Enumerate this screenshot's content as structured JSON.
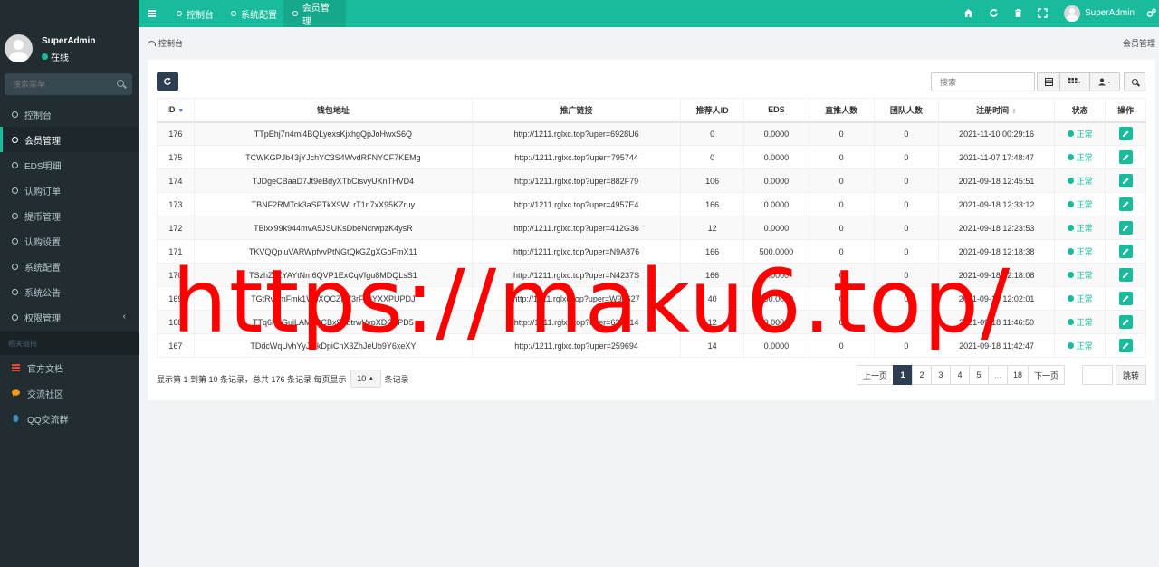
{
  "user": {
    "name": "SuperAdmin",
    "status": "在线"
  },
  "sidebar": {
    "search_placeholder": "搜索菜单",
    "items": [
      {
        "label": "控制台",
        "icon": "circle-icon"
      },
      {
        "label": "会员管理",
        "icon": "circle-icon",
        "active": true
      },
      {
        "label": "EDS明细",
        "icon": "circle-icon"
      },
      {
        "label": "认购订单",
        "icon": "circle-icon"
      },
      {
        "label": "提币管理",
        "icon": "circle-icon"
      },
      {
        "label": "认购设置",
        "icon": "circle-icon"
      },
      {
        "label": "系统配置",
        "icon": "circle-icon"
      },
      {
        "label": "系统公告",
        "icon": "circle-icon"
      },
      {
        "label": "权限管理",
        "icon": "circle-icon",
        "has_children": true
      }
    ],
    "links_header": "相关链接",
    "links": [
      {
        "label": "官方文档",
        "icon": "list-icon",
        "color": "#dd4b39"
      },
      {
        "label": "交流社区",
        "icon": "comment-icon",
        "color": "#f39c12"
      },
      {
        "label": "QQ交流群",
        "icon": "qq-icon",
        "color": "#3c8dbc"
      }
    ]
  },
  "topbar": {
    "tabs": [
      {
        "label": "控制台"
      },
      {
        "label": "系统配置"
      },
      {
        "label": "会员管理",
        "active": true
      }
    ],
    "username": "SuperAdmin",
    "icons": [
      "home-icon",
      "refresh-icon",
      "trash-icon",
      "fullscreen-icon",
      "settings-icon"
    ]
  },
  "breadcrumb": {
    "label": "控制台"
  },
  "page_title": "会员管理",
  "toolbar": {
    "search_placeholder": "搜索"
  },
  "table": {
    "headers": [
      "ID",
      "钱包地址",
      "推广链接",
      "推荐人ID",
      "EDS",
      "直推人数",
      "团队人数",
      "注册时间",
      "状态",
      "操作"
    ],
    "rows": [
      [
        "176",
        "TTpEhj7n4mi4BQLyexsKjxhgQpJoHwxS6Q",
        "http://1211.rglxc.top?uper=6928U6",
        "0",
        "0.0000",
        "0",
        "0",
        "2021-11-10 00:29:16",
        "正常"
      ],
      [
        "175",
        "TCWKGPJb43jYJchYC3S4WvdRFNYCF7KEMg",
        "http://1211.rglxc.top?uper=795744",
        "0",
        "0.0000",
        "0",
        "0",
        "2021-11-07 17:48:47",
        "正常"
      ],
      [
        "174",
        "TJDgeCBaaD7Jt9eBdyXTbCisvyUKnTHVD4",
        "http://1211.rglxc.top?uper=882F79",
        "106",
        "0.0000",
        "0",
        "0",
        "2021-09-18 12:45:51",
        "正常"
      ],
      [
        "173",
        "TBNF2RMTck3aSPTkX9WLrT1n7xX95KZruy",
        "http://1211.rglxc.top?uper=4957E4",
        "166",
        "0.0000",
        "0",
        "0",
        "2021-09-18 12:33:12",
        "正常"
      ],
      [
        "172",
        "TBixx99k944mvA5JSUKsDbeNcrwpzK4ysR",
        "http://1211.rglxc.top?uper=412G36",
        "12",
        "0.0000",
        "0",
        "0",
        "2021-09-18 12:23:53",
        "正常"
      ],
      [
        "171",
        "TKVQQpiuVARWpfvvPtNGtQkGZgXGoFmX11",
        "http://1211.rglxc.top?uper=N9A876",
        "166",
        "500.0000",
        "0",
        "0",
        "2021-09-18 12:18:38",
        "正常"
      ],
      [
        "170",
        "TSzhZcZYAYtNm6QVP1ExCqVfgu8MDQLsS1",
        "http://1211.rglxc.top?uper=N4237S",
        "166",
        "0.0000",
        "0",
        "0",
        "2021-09-18 12:18:08",
        "正常"
      ],
      [
        "169",
        "TGtRvgmFmk1WoXQCZFV3rFrNYXXPUPDJ",
        "http://1211.rglxc.top?uper=W96627",
        "40",
        "500.0000",
        "0",
        "0",
        "2021-09-18 12:02:01",
        "正常"
      ],
      [
        "168",
        "TTq6K2GujLAMuBCBx9SbtrwVypXDQ2PD5",
        "http://1211.rglxc.top?uper=636A14",
        "12",
        "0.0000",
        "0",
        "0",
        "2021-09-18 11:46:50",
        "正常"
      ],
      [
        "167",
        "TDdcWqUvhYyJmkDpiCnX3ZhJeUb9Y6xeXY",
        "http://1211.rglxc.top?uper=259694",
        "14",
        "0.0000",
        "0",
        "0",
        "2021-09-18 11:42:47",
        "正常"
      ]
    ]
  },
  "pagination": {
    "info_prefix": "显示第 1 到第 10 条记录，总共 176 条记录 每页显示",
    "page_size": "10",
    "info_suffix": "条记录",
    "prev": "上一页",
    "pages": [
      "1",
      "2",
      "3",
      "4",
      "5",
      "...",
      "18"
    ],
    "current": "1",
    "next": "下一页",
    "jump": "跳转"
  },
  "watermark": "https://maku6.top/",
  "colors": {
    "primary": "#18bc9c",
    "sidebar": "#222d32",
    "dark_button": "#2c3e50",
    "watermark": "#ff0000"
  }
}
